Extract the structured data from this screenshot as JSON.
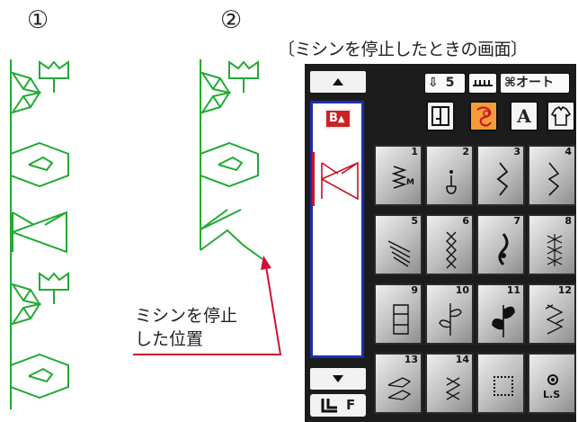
{
  "illustration": {
    "label_1": "①",
    "label_2": "②",
    "stop_note_line1": "ミシンを停止",
    "stop_note_line2": "した位置",
    "stitch_color": "#22aa33",
    "arrow_color": "#cc1133"
  },
  "screen": {
    "caption": "〔ミシンを停止したときの画面〕",
    "top_bar": {
      "foot_pressure": "5",
      "auto_label": "オート"
    },
    "tabs": [
      "straight-stitch-tab-icon",
      "decorative-stitch-tab-icon",
      "letter-tab-icon",
      "shirt-tab-icon"
    ],
    "tab_letter": "A",
    "active_tab": 1,
    "side": {
      "buttons": [
        "up-arrow-button",
        "down-arrow-button"
      ],
      "foot_label": "F",
      "pattern_badge": "B"
    },
    "grid": {
      "numbers": [
        "1",
        "2",
        "3",
        "4",
        "5",
        "6",
        "7",
        "8",
        "9",
        "10",
        "11",
        "12",
        "13",
        "14"
      ],
      "extra_label": "L.S"
    },
    "colors": {
      "panel": "#1c1c1c",
      "accent": "#f29d38",
      "selection": "#cc1122",
      "list_border": "#1a2fb0"
    }
  }
}
